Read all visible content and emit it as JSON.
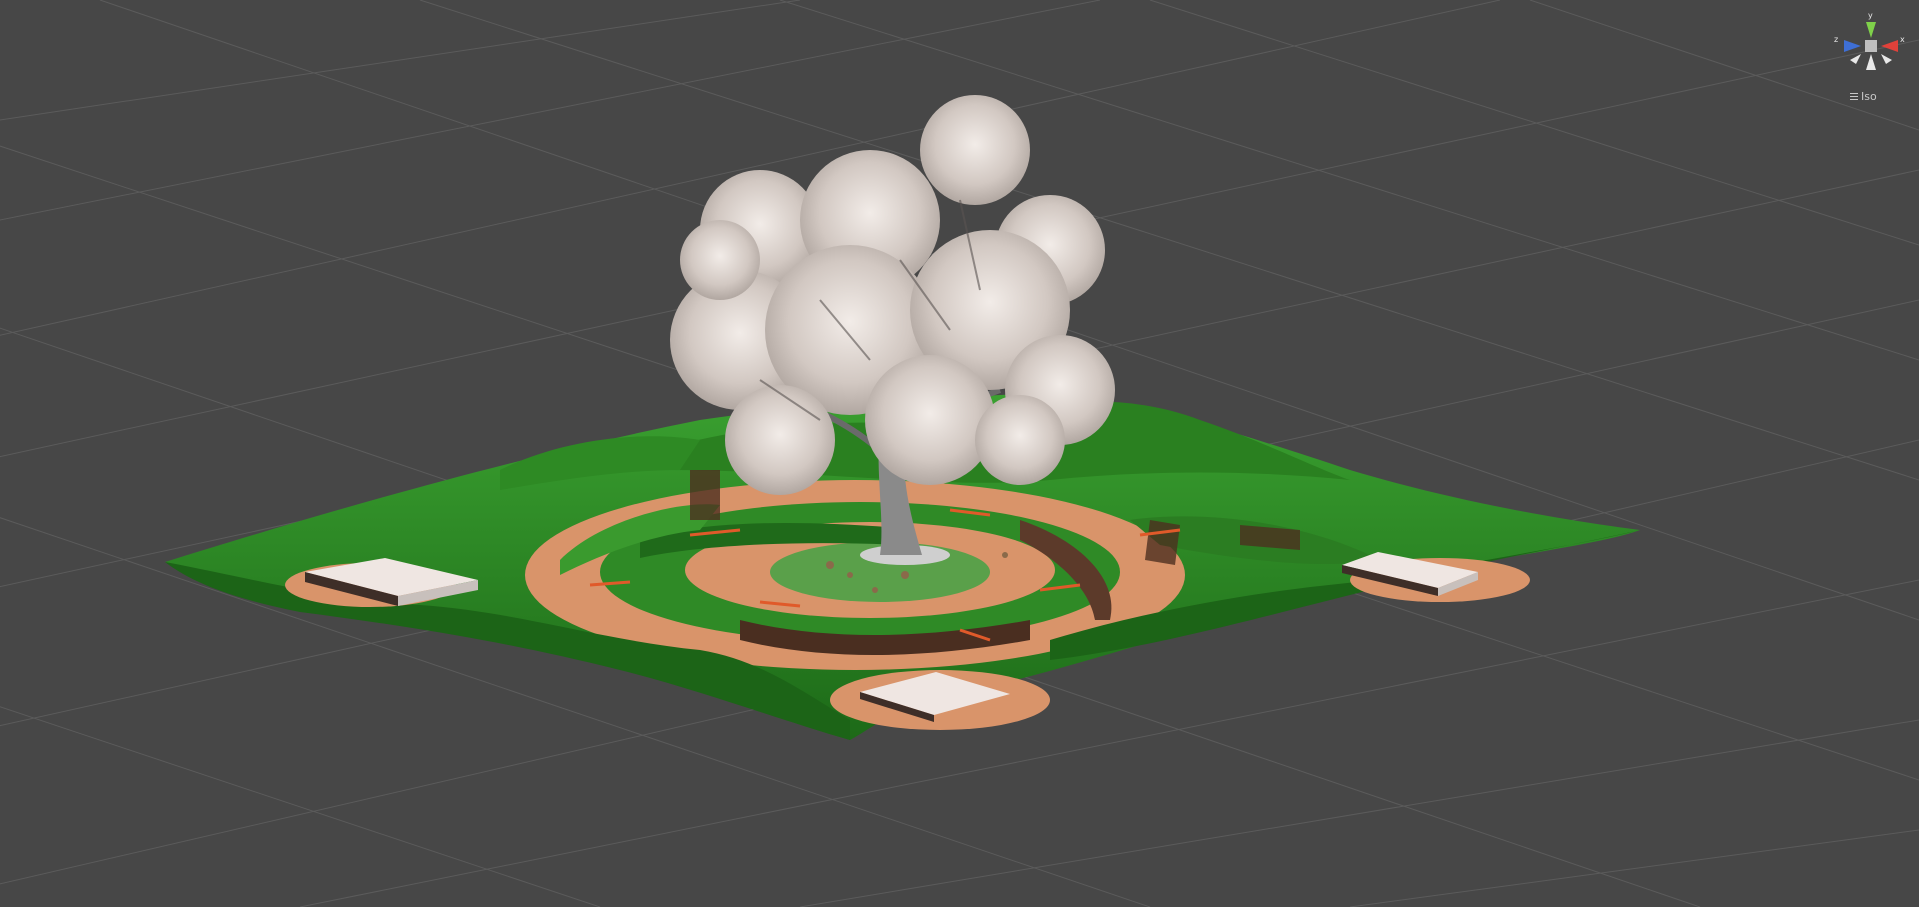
{
  "viewport": {
    "background": "#474747",
    "grid_color": "#5e5e5e",
    "projection_label": "Iso"
  },
  "gizmo": {
    "axes": [
      {
        "name": "y",
        "label": "y",
        "color": "#7fd14a"
      },
      {
        "name": "x",
        "label": "x",
        "color": "#e0413a"
      },
      {
        "name": "z",
        "label": "z",
        "color": "#3e6fd6"
      }
    ]
  },
  "scene_colors": {
    "grass": "#2f8a26",
    "grass_dark": "#1f6a1a",
    "dirt": "#d9946a",
    "cliff": "#5c3a2a",
    "tree_leaves": "#d8d0cc",
    "trunk": "#8a8a8a",
    "pad": "#efe6e2"
  }
}
